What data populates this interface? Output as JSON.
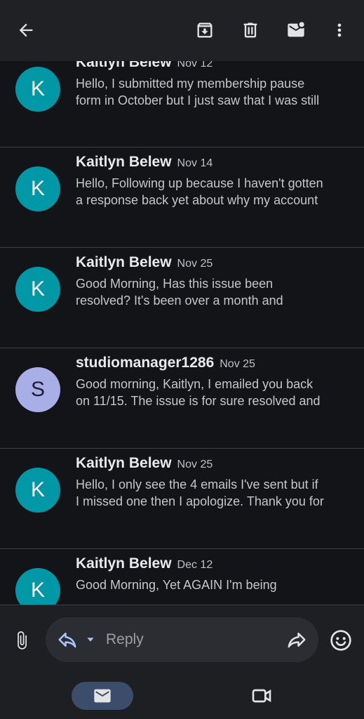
{
  "toolbar": {
    "back_icon": "arrow-left-icon",
    "archive_icon": "archive-icon",
    "delete_icon": "trash-icon",
    "mark_unread_icon": "mail-unread-icon",
    "more_icon": "more-vert-icon"
  },
  "messages": [
    {
      "avatar": "K",
      "avatar_color": "#0097a7",
      "sender": "Kaitlyn Belew",
      "date": "Nov 12",
      "snippet_line1": "Hello, I submitted my membership pause",
      "snippet_line2": "form in October but I just saw that I was still"
    },
    {
      "avatar": "K",
      "avatar_color": "#0097a7",
      "sender": "Kaitlyn Belew",
      "date": "Nov 14",
      "snippet_line1": "Hello, Following up because I haven't gotten",
      "snippet_line2": "a response back yet about why my account"
    },
    {
      "avatar": "K",
      "avatar_color": "#0097a7",
      "sender": "Kaitlyn Belew",
      "date": "Nov 25",
      "snippet_line1": "Good Morning, Has this issue been",
      "snippet_line2": "resolved? It's been over a month and"
    },
    {
      "avatar": "S",
      "avatar_color": "#a8aee6",
      "sender": "studiomanager1286",
      "date": "Nov 25",
      "snippet_line1": "Good morning, Kaitlyn, I emailed you back",
      "snippet_line2": "on 11/15. The issue is for sure resolved and"
    },
    {
      "avatar": "K",
      "avatar_color": "#0097a7",
      "sender": "Kaitlyn Belew",
      "date": "Nov 25",
      "snippet_line1": "Hello, I only see the 4 emails I've sent but if",
      "snippet_line2": "I missed one then I apologize. Thank you for"
    },
    {
      "avatar": "K",
      "avatar_color": "#0097a7",
      "sender": "Kaitlyn Belew",
      "date": "Dec 12",
      "snippet_line1": "Good Morning, Yet AGAIN I'm being",
      "snippet_line2": ""
    }
  ],
  "reply_bar": {
    "attach_icon": "paperclip-icon",
    "reply_label": "Reply",
    "reply_icon": "reply-icon",
    "forward_icon": "forward-icon",
    "emoji_icon": "emoji-icon"
  },
  "bottom_nav": {
    "mail_icon": "mail-icon",
    "meet_icon": "video-camera-icon"
  }
}
